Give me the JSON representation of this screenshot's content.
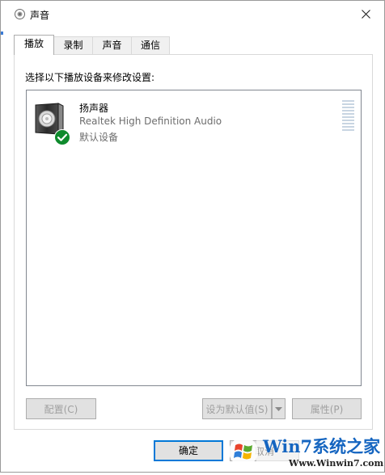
{
  "window": {
    "title": "声音",
    "title_icon": "speaker-icon",
    "close_icon": "close-icon"
  },
  "tabs": [
    {
      "label": "播放",
      "active": true
    },
    {
      "label": "录制",
      "active": false
    },
    {
      "label": "声音",
      "active": false
    },
    {
      "label": "通信",
      "active": false
    }
  ],
  "playback": {
    "instruction": "选择以下播放设备来修改设置:",
    "devices": [
      {
        "name": "扬声器",
        "driver": "Realtek High Definition Audio",
        "status": "默认设备",
        "icon": "speaker-icon",
        "badge_icon": "check-icon",
        "level": 0
      }
    ]
  },
  "buttons": {
    "configure": "配置(C)",
    "set_default": "设为默认值(S)",
    "properties": "属性(P)",
    "ok": "确定",
    "cancel": "取消"
  },
  "watermark": {
    "brand": "Win7系统之家",
    "url": "Www.Winwin7.com"
  },
  "colors": {
    "accent": "#0078d7",
    "check_badge": "#0e8a2c",
    "meter": "#c8d5e2"
  }
}
